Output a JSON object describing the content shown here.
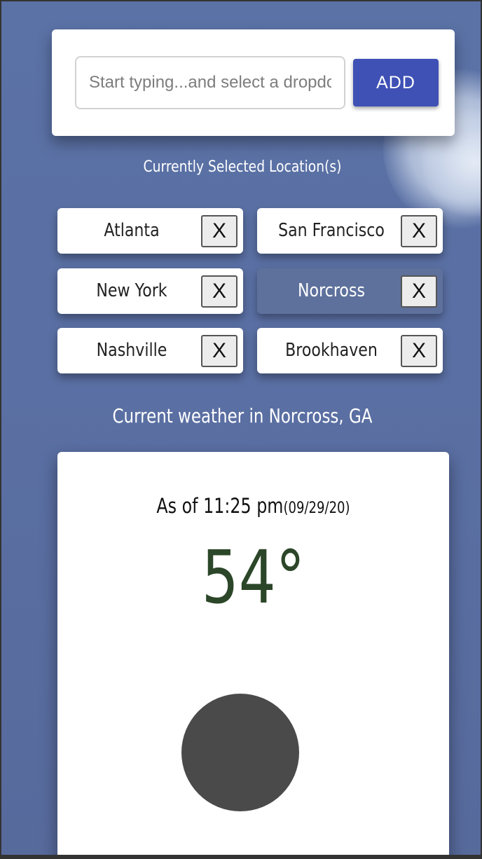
{
  "search": {
    "placeholder": "Start typing...and select a dropdown",
    "add_label": "ADD"
  },
  "selected_heading": "Currently Selected Location(s)",
  "locations": [
    {
      "label": "Atlanta",
      "remove_label": "X",
      "active": false
    },
    {
      "label": "San Francisco",
      "remove_label": "X",
      "active": false
    },
    {
      "label": "New York",
      "remove_label": "X",
      "active": false
    },
    {
      "label": "Norcross",
      "remove_label": "X",
      "active": true
    },
    {
      "label": "Nashville",
      "remove_label": "X",
      "active": false
    },
    {
      "label": "Brookhaven",
      "remove_label": "X",
      "active": false
    }
  ],
  "weather": {
    "heading": "Current weather in Norcross, GA",
    "as_of_time": "As of 11:25 pm",
    "as_of_date": "(09/29/20)",
    "temperature": "54°",
    "icon": "weather-circle-icon"
  },
  "colors": {
    "accent": "#3f51b5",
    "temperature": "#2b4628",
    "active_chip": "#5e719c",
    "background": "#5b6e9e"
  }
}
